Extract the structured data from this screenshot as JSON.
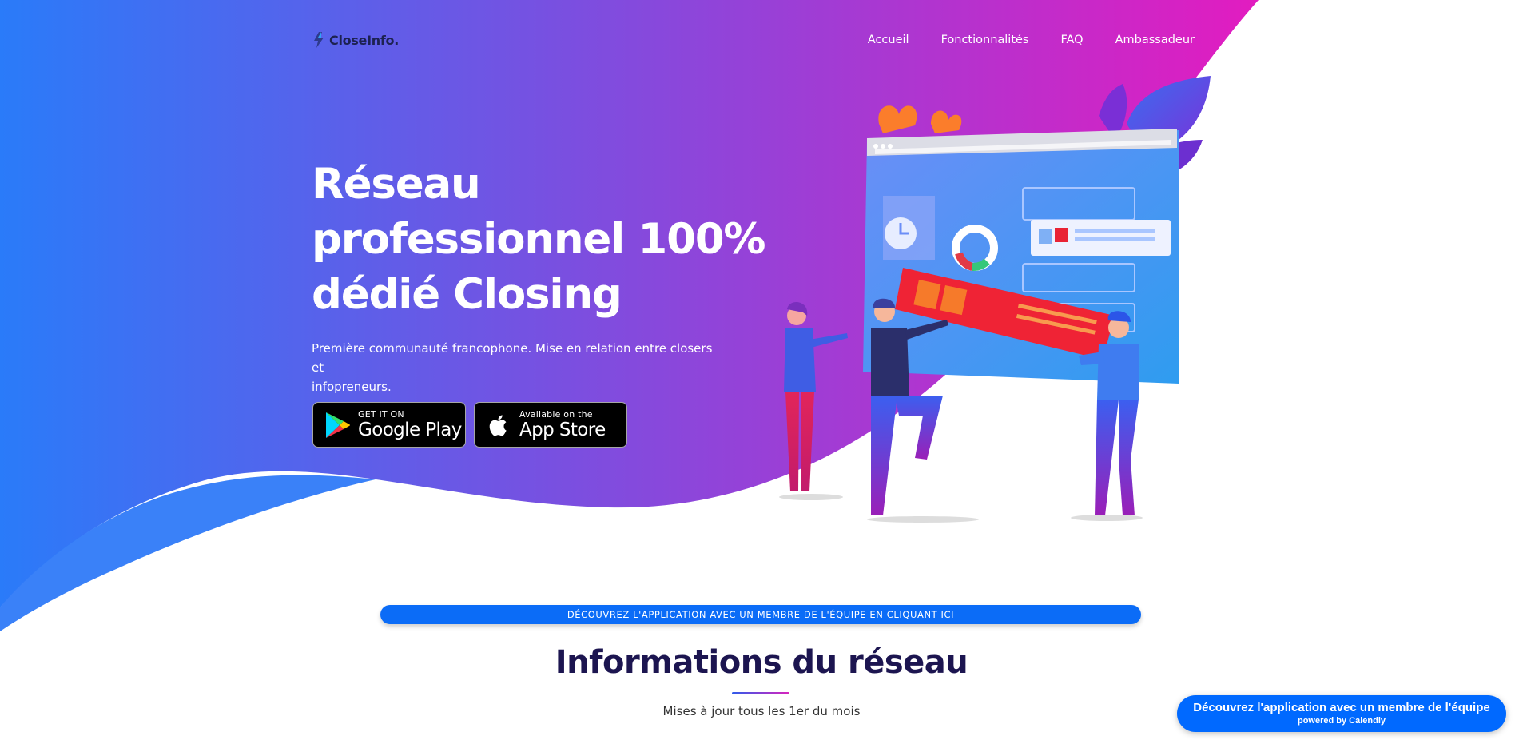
{
  "brand": {
    "name": "CloseInfo."
  },
  "nav": {
    "items": [
      {
        "label": "Accueil"
      },
      {
        "label": "Fonctionnalités"
      },
      {
        "label": "FAQ"
      },
      {
        "label": "Ambassadeur"
      }
    ]
  },
  "hero": {
    "title_line1": "Réseau",
    "title_line2": "professionnel 100%",
    "title_line3": "dédié Closing",
    "subtitle_line1": "Première communauté francophone. Mise en relation entre closers et",
    "subtitle_line2": "infopreneurs."
  },
  "stores": {
    "google": {
      "small": "GET IT ON",
      "big": "Google Play"
    },
    "apple": {
      "small": "Available on the",
      "big": "App Store"
    }
  },
  "cta": {
    "label": "Découvrez l'application avec un membre de l'équipe en cliquant ici"
  },
  "info_section": {
    "title": "Informations du réseau",
    "subtitle": "Mises à jour tous les 1er du mois"
  },
  "calendly": {
    "label": "Découvrez l'application avec un membre de l'équipe",
    "powered": "powered by Calendly"
  },
  "colors": {
    "hero_gradient_start": "#2a7bf9",
    "hero_gradient_mid": "#7a4fe0",
    "hero_gradient_end": "#e21cc0",
    "accent_blue": "#0b6cf7",
    "calendly_blue": "#0069ff",
    "title_navy": "#1c1550"
  },
  "icons": [
    "closeinfo-logo-icon",
    "google-play-icon",
    "apple-icon"
  ]
}
